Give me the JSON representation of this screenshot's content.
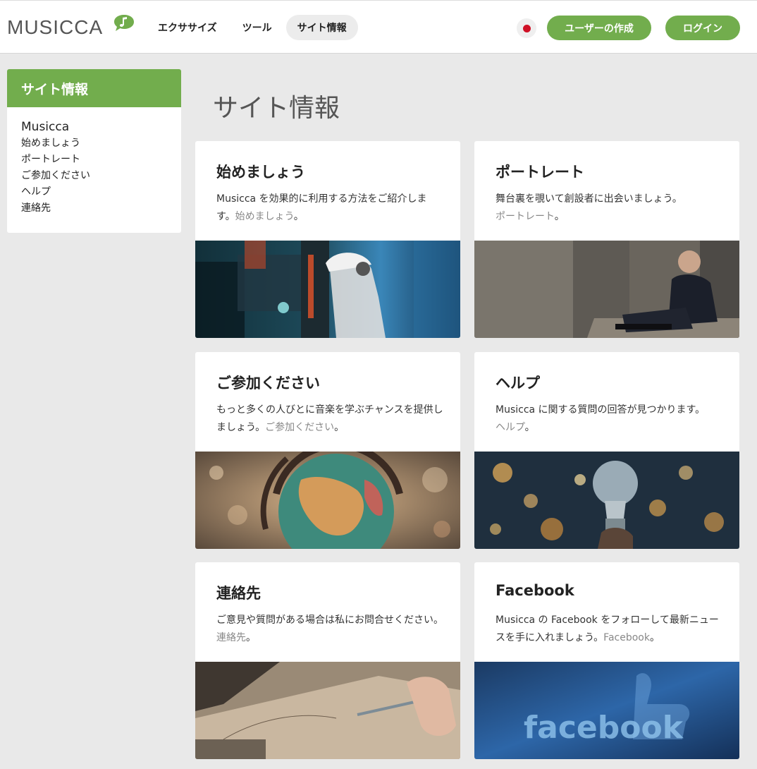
{
  "header": {
    "logo": "MUSICCA",
    "nav": [
      {
        "label": "エクササイズ"
      },
      {
        "label": "ツール"
      },
      {
        "label": "サイト情報"
      }
    ],
    "signup_label": "ユーザーの作成",
    "login_label": "ログイン"
  },
  "sidebar": {
    "heading": "サイト情報",
    "title": "Musicca",
    "links": [
      {
        "label": "始めましょう"
      },
      {
        "label": "ポートレート"
      },
      {
        "label": "ご参加ください"
      },
      {
        "label": "ヘルプ"
      },
      {
        "label": "連絡先"
      }
    ]
  },
  "main": {
    "title": "サイト情報",
    "cards": [
      {
        "title": "始めましょう",
        "text": "Musicca を効果的に利用する方法をご紹介します。",
        "link": "始めましょう",
        "suffix": "。"
      },
      {
        "title": "ポートレート",
        "text": "舞台裏を覗いて創設者に出会いましょう。",
        "link": "ポートレート",
        "suffix": "。"
      },
      {
        "title": "ご参加ください",
        "text": "もっと多くの人びとに音楽を学ぶチャンスを提供しましょう。",
        "link": "ご参加ください",
        "suffix": "。"
      },
      {
        "title": "ヘルプ",
        "text": "Musicca に関する質問の回答が見つかります。",
        "link": "ヘルプ",
        "suffix": "。"
      },
      {
        "title": "連絡先",
        "text": "ご意見や質問がある場合は私にお問合せください。",
        "link": "連絡先",
        "suffix": "。"
      },
      {
        "title": "Facebook",
        "text": "Musicca の Facebook をフォローして最新ニュースを手に入れましょう。",
        "link": "Facebook",
        "suffix": "。"
      }
    ],
    "facebook_image_text": "facebook"
  },
  "colors": {
    "accent": "#72ad4d",
    "background": "#e9e9e9",
    "link_gray": "#888888"
  }
}
